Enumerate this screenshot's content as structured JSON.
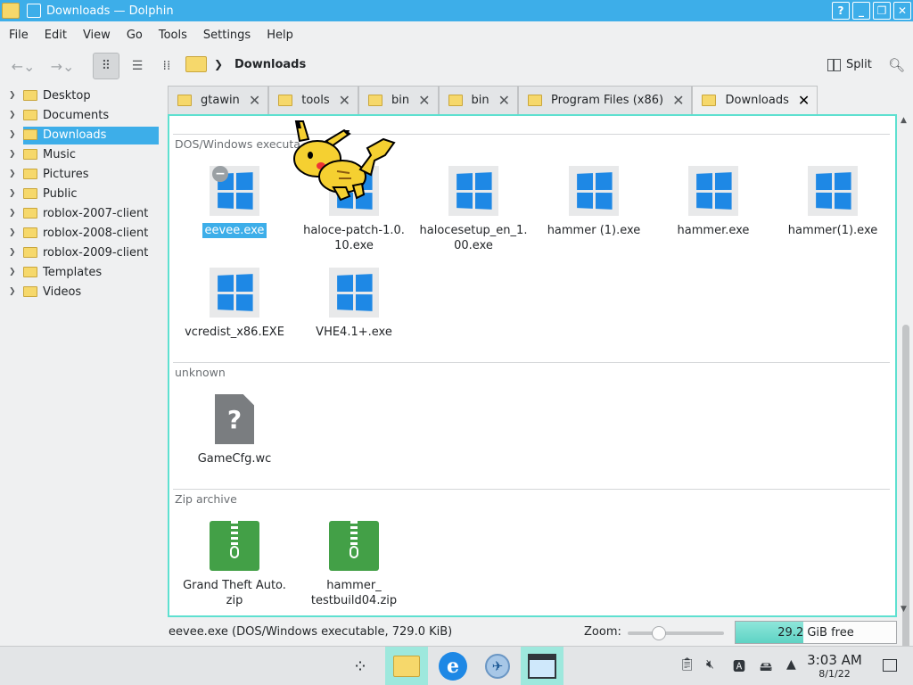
{
  "window": {
    "title": "Downloads — Dolphin"
  },
  "menubar": [
    "File",
    "Edit",
    "View",
    "Go",
    "Tools",
    "Settings",
    "Help"
  ],
  "toolbar": {
    "current_folder": "Downloads",
    "split_label": "Split"
  },
  "places": [
    {
      "label": "Desktop"
    },
    {
      "label": "Documents"
    },
    {
      "label": "Downloads",
      "selected": true
    },
    {
      "label": "Music"
    },
    {
      "label": "Pictures"
    },
    {
      "label": "Public"
    },
    {
      "label": "roblox-2007-client"
    },
    {
      "label": "roblox-2008-client"
    },
    {
      "label": "roblox-2009-client"
    },
    {
      "label": "Templates"
    },
    {
      "label": "Videos"
    }
  ],
  "tabs": [
    {
      "label": "gtawin"
    },
    {
      "label": "tools"
    },
    {
      "label": "bin"
    },
    {
      "label": "bin"
    },
    {
      "label": "Program Files (x86)"
    },
    {
      "label": "Downloads",
      "active": true
    }
  ],
  "groups": [
    {
      "title": "DOS/Windows executa",
      "items": [
        {
          "name": "eevee.exe",
          "icon": "windows-exe-icon",
          "selected": true
        },
        {
          "name": "haloce-patch-1.0.10.exe",
          "lines": [
            "haloce-patch-1.0.",
            "10.exe"
          ],
          "icon": "windows-exe-icon"
        },
        {
          "name": "halocesetup_en_1.00.exe",
          "lines": [
            "halocesetup_en_1.",
            "00.exe"
          ],
          "icon": "windows-exe-icon"
        },
        {
          "name": "hammer (1).exe",
          "icon": "windows-exe-icon"
        },
        {
          "name": "hammer.exe",
          "icon": "windows-exe-icon"
        },
        {
          "name": "hammer(1).exe",
          "icon": "windows-exe-icon"
        },
        {
          "name": "vcredist_x86.EXE",
          "icon": "windows-exe-icon"
        },
        {
          "name": "VHE4.1+.exe",
          "icon": "windows-exe-icon"
        }
      ]
    },
    {
      "title": "unknown",
      "items": [
        {
          "name": "GameCfg.wc",
          "icon": "unknown-file-icon"
        }
      ]
    },
    {
      "title": "Zip archive",
      "items": [
        {
          "name": "Grand Theft Auto.zip",
          "lines": [
            "Grand Theft Auto.",
            "zip"
          ],
          "icon": "zip-archive-icon"
        },
        {
          "name": "hammer_testbuild04.zip",
          "lines": [
            "hammer_",
            "testbuild04.zip"
          ],
          "icon": "zip-archive-icon"
        }
      ]
    }
  ],
  "statusbar": {
    "status": "eevee.exe (DOS/Windows executable, 729.0 KiB)",
    "zoom_label": "Zoom:",
    "zoom_level": 0.25,
    "free_space": "29.2 GiB free",
    "disk_used_fraction": 0.42
  },
  "taskbar": {
    "clock_time": "3:03 AM",
    "clock_date": "8/1/22"
  },
  "colors": {
    "accent": "#3daee9",
    "focus_frame": "#5ee0d0",
    "exe_icon_blue": "#1e88e5",
    "zip_green": "#43a047"
  }
}
